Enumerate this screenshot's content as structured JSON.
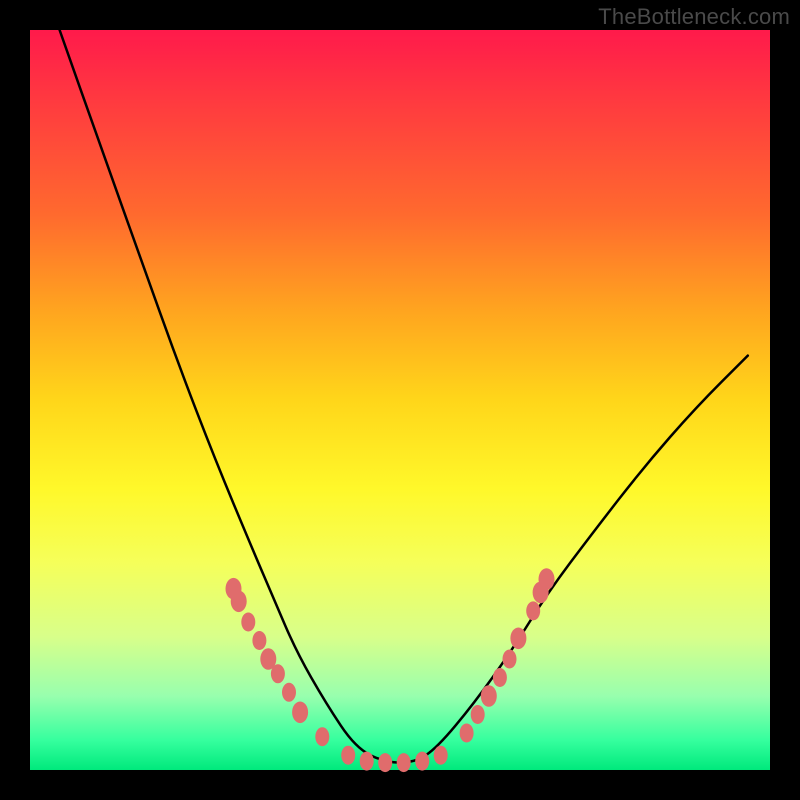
{
  "watermark": "TheBottleneck.com",
  "chart_data": {
    "type": "line",
    "title": "",
    "xlabel": "",
    "ylabel": "",
    "xlim": [
      0,
      1
    ],
    "ylim": [
      0,
      1
    ],
    "series": [
      {
        "name": "curve",
        "x": [
          0.04,
          0.1,
          0.15,
          0.2,
          0.25,
          0.3,
          0.33,
          0.36,
          0.4,
          0.44,
          0.48,
          0.52,
          0.55,
          0.6,
          0.65,
          0.7,
          0.76,
          0.83,
          0.9,
          0.97
        ],
        "y": [
          1.0,
          0.83,
          0.69,
          0.55,
          0.42,
          0.3,
          0.23,
          0.16,
          0.09,
          0.03,
          0.01,
          0.01,
          0.03,
          0.09,
          0.16,
          0.24,
          0.32,
          0.41,
          0.49,
          0.56
        ]
      }
    ],
    "markers": [
      {
        "x": 0.275,
        "y": 0.245,
        "r": 8
      },
      {
        "x": 0.282,
        "y": 0.228,
        "r": 8
      },
      {
        "x": 0.295,
        "y": 0.2,
        "r": 7
      },
      {
        "x": 0.31,
        "y": 0.175,
        "r": 7
      },
      {
        "x": 0.322,
        "y": 0.15,
        "r": 8
      },
      {
        "x": 0.335,
        "y": 0.13,
        "r": 7
      },
      {
        "x": 0.35,
        "y": 0.105,
        "r": 7
      },
      {
        "x": 0.365,
        "y": 0.078,
        "r": 8
      },
      {
        "x": 0.395,
        "y": 0.045,
        "r": 7
      },
      {
        "x": 0.43,
        "y": 0.02,
        "r": 7
      },
      {
        "x": 0.455,
        "y": 0.012,
        "r": 7
      },
      {
        "x": 0.48,
        "y": 0.01,
        "r": 7
      },
      {
        "x": 0.505,
        "y": 0.01,
        "r": 7
      },
      {
        "x": 0.53,
        "y": 0.012,
        "r": 7
      },
      {
        "x": 0.555,
        "y": 0.02,
        "r": 7
      },
      {
        "x": 0.59,
        "y": 0.05,
        "r": 7
      },
      {
        "x": 0.605,
        "y": 0.075,
        "r": 7
      },
      {
        "x": 0.62,
        "y": 0.1,
        "r": 8
      },
      {
        "x": 0.635,
        "y": 0.125,
        "r": 7
      },
      {
        "x": 0.648,
        "y": 0.15,
        "r": 7
      },
      {
        "x": 0.66,
        "y": 0.178,
        "r": 8
      },
      {
        "x": 0.68,
        "y": 0.215,
        "r": 7
      },
      {
        "x": 0.69,
        "y": 0.24,
        "r": 8
      },
      {
        "x": 0.698,
        "y": 0.258,
        "r": 8
      }
    ],
    "marker_color": "#e06c6c",
    "curve_color": "#000000"
  }
}
